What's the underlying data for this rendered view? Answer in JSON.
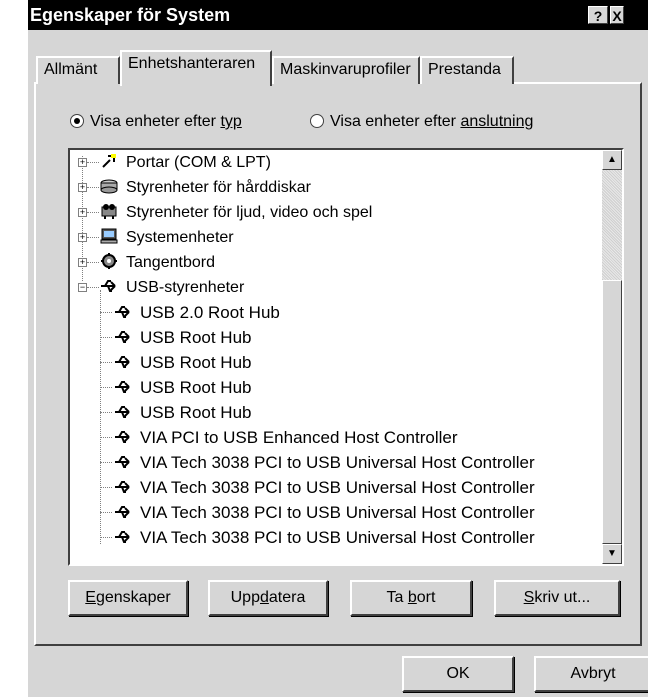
{
  "window": {
    "title": "Egenskaper för System",
    "help_label": "?",
    "close_label": "X"
  },
  "tabs": [
    {
      "label": "Allmänt"
    },
    {
      "label": "Enhetshanteraren"
    },
    {
      "label": "Maskinvaruprofiler"
    },
    {
      "label": "Prestanda"
    }
  ],
  "view": {
    "by_type_pre": "Visa enheter efter ",
    "by_type_key": "typ",
    "by_connection_pre": "Visa enheter efter ",
    "by_connection_key": "anslutning"
  },
  "tree": {
    "categories": [
      {
        "label": "Portar (COM & LPT)",
        "icon": "port-icon"
      },
      {
        "label": "Styrenheter för hårddiskar",
        "icon": "disk-controller-icon"
      },
      {
        "label": "Styrenheter för ljud, video och spel",
        "icon": "sound-icon"
      },
      {
        "label": "Systemenheter",
        "icon": "computer-icon"
      },
      {
        "label": "Tangentbord",
        "icon": "keyboard-icon"
      },
      {
        "label": "USB-styrenheter",
        "icon": "usb-icon"
      }
    ],
    "usb_children": [
      {
        "label": "USB 2.0 Root Hub"
      },
      {
        "label": "USB Root Hub"
      },
      {
        "label": "USB Root Hub"
      },
      {
        "label": "USB Root Hub"
      },
      {
        "label": "USB Root Hub"
      },
      {
        "label": "VIA PCI to USB Enhanced Host Controller"
      },
      {
        "label": "VIA Tech 3038 PCI to USB Universal Host Controller"
      },
      {
        "label": "VIA Tech 3038 PCI to USB Universal Host Controller"
      },
      {
        "label": "VIA Tech 3038 PCI to USB Universal Host Controller"
      },
      {
        "label": "VIA Tech 3038 PCI to USB Universal Host Controller"
      }
    ]
  },
  "buttons": {
    "properties_key": "E",
    "properties_rest": "genskaper",
    "update_pre": "Upp",
    "update_key": "d",
    "update_rest": "atera",
    "remove_pre": "Ta ",
    "remove_key": "b",
    "remove_rest": "ort",
    "print_key": "S",
    "print_rest": "kriv ut...",
    "ok": "OK",
    "cancel": "Avbryt"
  }
}
